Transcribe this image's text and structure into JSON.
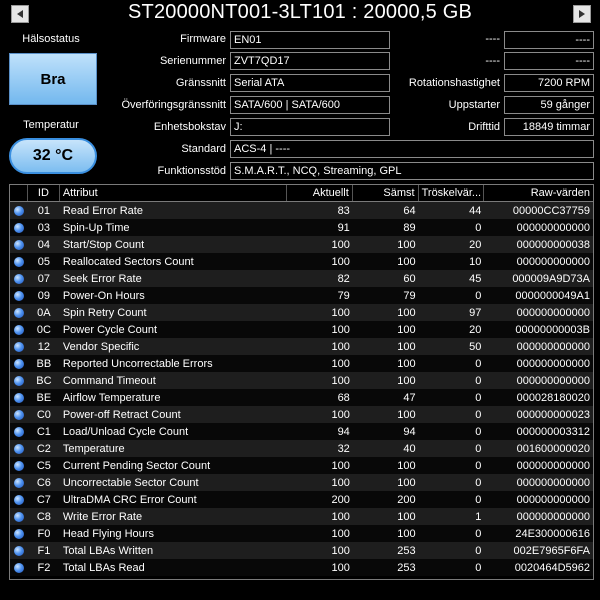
{
  "title": "ST20000NT001-3LT101 : 20000,5 GB",
  "nav": {
    "prev_icon": "triangle-left",
    "next_icon": "triangle-right"
  },
  "left": {
    "health_label": "Hälsostatus",
    "health_value": "Bra",
    "temp_label": "Temperatur",
    "temp_value": "32 °C",
    "health_color": "#7ab9ee"
  },
  "info": {
    "firmware_label": "Firmware",
    "firmware": "EN01",
    "serial_label": "Serienummer",
    "serial": "ZVT7QD17",
    "interface_label": "Gränssnitt",
    "interface": "Serial ATA",
    "transfer_label": "Överföringsgränssnitt",
    "transfer": "SATA/600 | SATA/600",
    "drive_label": "Enhetsbokstav",
    "drive": "J:",
    "standard_label": "Standard",
    "standard": "ACS-4 | ----",
    "features_label": "Funktionsstöd",
    "features": "S.M.A.R.T., NCQ, Streaming, GPL",
    "unk1_label": "----",
    "unk1": "----",
    "unk2_label": "----",
    "unk2": "----",
    "rotation_label": "Rotationshastighet",
    "rotation": "7200 RPM",
    "starts_label": "Uppstarter",
    "starts": "59 gånger",
    "hours_label": "Drifttid",
    "hours": "18849 timmar"
  },
  "table": {
    "headers": [
      "ID",
      "Attribut",
      "Aktuellt",
      "Sämst",
      "Tröskelvär...",
      "Raw-värden"
    ],
    "rows": [
      [
        "01",
        "Read Error Rate",
        "83",
        "64",
        "44",
        "00000CC37759"
      ],
      [
        "03",
        "Spin-Up Time",
        "91",
        "89",
        "0",
        "000000000000"
      ],
      [
        "04",
        "Start/Stop Count",
        "100",
        "100",
        "20",
        "000000000038"
      ],
      [
        "05",
        "Reallocated Sectors Count",
        "100",
        "100",
        "10",
        "000000000000"
      ],
      [
        "07",
        "Seek Error Rate",
        "82",
        "60",
        "45",
        "000009A9D73A"
      ],
      [
        "09",
        "Power-On Hours",
        "79",
        "79",
        "0",
        "0000000049A1"
      ],
      [
        "0A",
        "Spin Retry Count",
        "100",
        "100",
        "97",
        "000000000000"
      ],
      [
        "0C",
        "Power Cycle Count",
        "100",
        "100",
        "20",
        "00000000003B"
      ],
      [
        "12",
        "Vendor Specific",
        "100",
        "100",
        "50",
        "000000000000"
      ],
      [
        "BB",
        "Reported Uncorrectable Errors",
        "100",
        "100",
        "0",
        "000000000000"
      ],
      [
        "BC",
        "Command Timeout",
        "100",
        "100",
        "0",
        "000000000000"
      ],
      [
        "BE",
        "Airflow Temperature",
        "68",
        "47",
        "0",
        "000028180020"
      ],
      [
        "C0",
        "Power-off Retract Count",
        "100",
        "100",
        "0",
        "000000000023"
      ],
      [
        "C1",
        "Load/Unload Cycle Count",
        "94",
        "94",
        "0",
        "000000003312"
      ],
      [
        "C2",
        "Temperature",
        "32",
        "40",
        "0",
        "001600000020"
      ],
      [
        "C5",
        "Current Pending Sector Count",
        "100",
        "100",
        "0",
        "000000000000"
      ],
      [
        "C6",
        "Uncorrectable Sector Count",
        "100",
        "100",
        "0",
        "000000000000"
      ],
      [
        "C7",
        "UltraDMA CRC Error Count",
        "200",
        "200",
        "0",
        "000000000000"
      ],
      [
        "C8",
        "Write Error Rate",
        "100",
        "100",
        "1",
        "000000000000"
      ],
      [
        "F0",
        "Head Flying Hours",
        "100",
        "100",
        "0",
        "24E300000616"
      ],
      [
        "F1",
        "Total LBAs Written",
        "100",
        "253",
        "0",
        "002E7965F6FA"
      ],
      [
        "F2",
        "Total LBAs Read",
        "100",
        "253",
        "0",
        "0020464D5962"
      ]
    ]
  }
}
